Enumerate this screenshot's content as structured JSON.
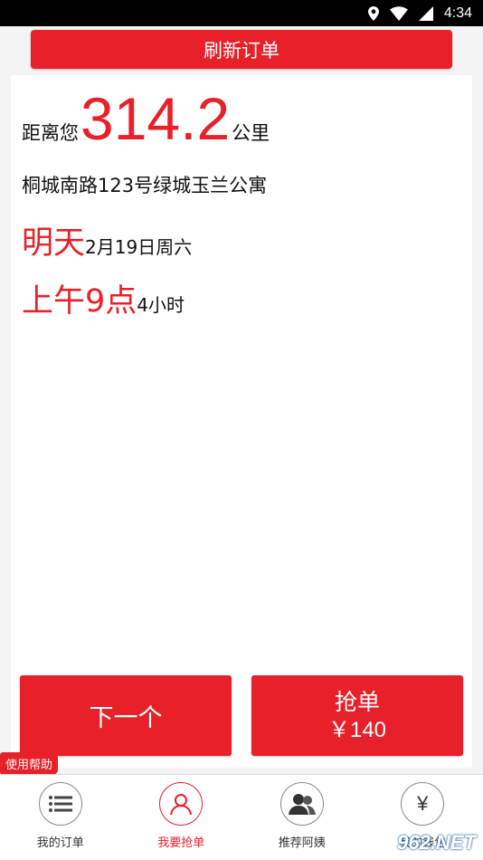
{
  "status_bar": {
    "time": "4:34"
  },
  "header": {
    "refresh_label": "刷新订单"
  },
  "order": {
    "distance_prefix": "距离您",
    "distance_value": "314.2",
    "distance_unit": "公里",
    "address": "桐城南路123号绿城玉兰公寓",
    "day_label": "明天",
    "date_text": "2月19日周六",
    "time_label": "上午9点",
    "duration_text": "4小时"
  },
  "actions": {
    "next_label": "下一个",
    "grab_label": "抢单",
    "grab_price": "￥140"
  },
  "help_label": "使用帮助",
  "tabs": [
    {
      "label": "我的订单",
      "icon": "list-icon"
    },
    {
      "label": "我要抢单",
      "icon": "person-icon"
    },
    {
      "label": "推荐阿姨",
      "icon": "people-icon"
    },
    {
      "label": "我的钱包",
      "icon": "yen-icon"
    }
  ],
  "watermark": "962.NET",
  "colors": {
    "accent": "#e8202a",
    "status_bar": "#000000"
  }
}
